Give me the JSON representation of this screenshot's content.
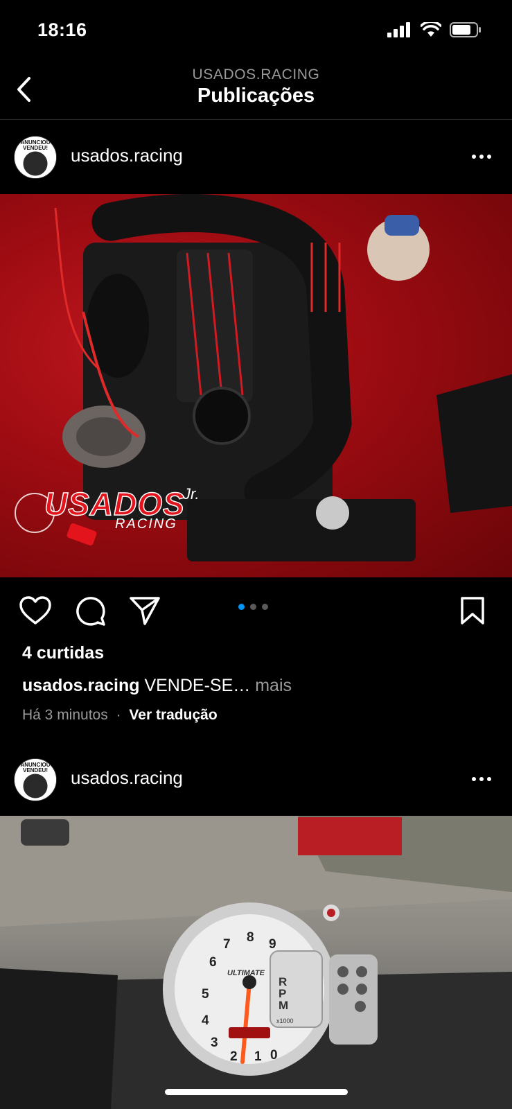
{
  "status_bar": {
    "time": "18:16"
  },
  "header": {
    "account": "USADOS.RACING",
    "title": "Publicações"
  },
  "posts": [
    {
      "username": "usados.racing",
      "avatar_text": "ANUNCIOU VENDEU!",
      "image_overlay": {
        "brand": "USADOS",
        "brand_suffix": "Jr.",
        "sub": "RACING"
      },
      "carousel": {
        "count": 3,
        "active": 0
      },
      "likes": "4 curtidas",
      "caption_user": "usados.racing",
      "caption_text": "VENDE-SE…",
      "caption_more": "mais",
      "time": "Há 3 minutos",
      "separator": "·",
      "translate": "Ver tradução"
    },
    {
      "username": "usados.racing",
      "avatar_text": "ANUNCIOU VENDEU!",
      "gauge": {
        "brand": "ULTIMATE",
        "unit": "RPM",
        "multiplier": "x1000",
        "numbers": [
          "0",
          "1",
          "2",
          "3",
          "4",
          "5",
          "6",
          "7",
          "8",
          "9"
        ]
      }
    }
  ],
  "colors": {
    "accent_blue": "#0095f6",
    "racing_red": "#e3141c"
  },
  "icons": [
    "back-chevron-icon",
    "signal-icon",
    "wifi-icon",
    "battery-icon",
    "more-icon",
    "heart-icon",
    "comment-icon",
    "share-icon",
    "bookmark-icon"
  ]
}
